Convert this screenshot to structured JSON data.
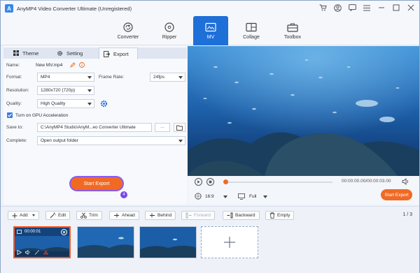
{
  "app": {
    "title": "AnyMP4 Video Converter Ultimate (Unregistered)",
    "logo_letter": "A"
  },
  "nav": {
    "tabs": [
      {
        "label": "Converter",
        "icon": "converter-icon"
      },
      {
        "label": "Ripper",
        "icon": "ripper-icon"
      },
      {
        "label": "MV",
        "icon": "mv-icon",
        "active": true
      },
      {
        "label": "Collage",
        "icon": "collage-icon"
      },
      {
        "label": "Toolbox",
        "icon": "toolbox-icon"
      }
    ]
  },
  "subtabs": {
    "theme": "Theme",
    "setting": "Setting",
    "export": "Export"
  },
  "export": {
    "name_label": "Name:",
    "name_value": "New MV.mp4",
    "format_label": "Format:",
    "format_value": "MP4",
    "frame_rate_label": "Frame Rate:",
    "frame_rate_value": "24fps",
    "resolution_label": "Resolution:",
    "resolution_value": "1280x720 (720p)",
    "quality_label": "Quality:",
    "quality_value": "High Quality",
    "gpu_label": "Turn on GPU Acceleration",
    "gpu_checked": true,
    "save_to_label": "Save to:",
    "save_to_value": "C:\\AnyMP4 Studio\\AnyM...eo Converter Ultimate",
    "browse_label": "···",
    "complete_label": "Complete:",
    "complete_value": "Open output folder",
    "start_export": "Start Export",
    "step_badge": "4"
  },
  "player": {
    "time": "00:00:00.00/00:00:03.00",
    "aspect": "16:9",
    "view": "Full",
    "start_export": "Start Export",
    "progress": 0
  },
  "toolbar": {
    "add": "Add",
    "edit": "Edit",
    "trim": "Trim",
    "ahead": "Ahead",
    "behind": "Behind",
    "forward": "Forward",
    "backward": "Backward",
    "empty": "Empty",
    "page": "1 / 3"
  },
  "timeline": {
    "clips": [
      {
        "duration": "00:00:01"
      },
      {},
      {}
    ]
  },
  "colors": {
    "accent": "#1f6fd9",
    "orange": "#f06a24",
    "badge": "#7a48e8"
  }
}
